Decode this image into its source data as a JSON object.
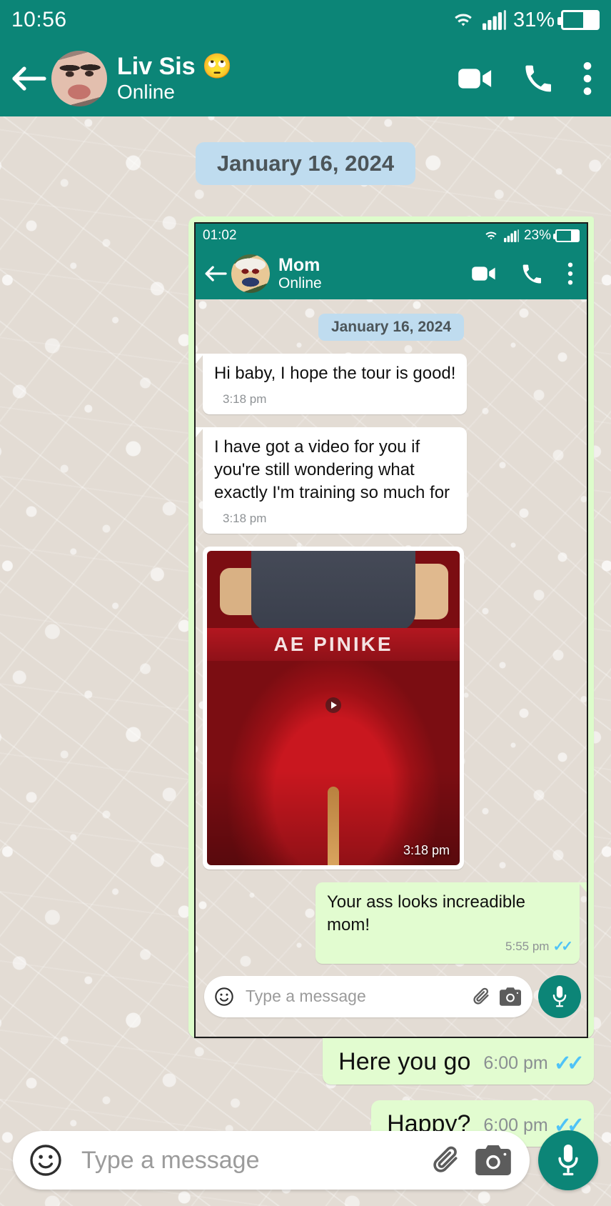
{
  "outer": {
    "status_bar": {
      "time": "10:56",
      "battery_percent": "31%",
      "wifi_icon": "wifi-icon",
      "signal_icon": "signal-icon",
      "battery_icon": "battery-icon"
    },
    "header": {
      "back_icon": "back-arrow-icon",
      "avatar": "contact-avatar",
      "name": "Liv Sis 🙄",
      "status": "Online",
      "video_call_icon": "video-call-icon",
      "voice_call_icon": "phone-call-icon",
      "menu_icon": "overflow-menu-icon"
    },
    "date_divider": "January 16, 2024",
    "messages": [
      {
        "type": "screenshot",
        "direction": "out"
      },
      {
        "type": "text",
        "direction": "out",
        "text": "Here you go",
        "time": "6:00 pm",
        "ticks": "read"
      },
      {
        "type": "text",
        "direction": "out",
        "text": "Happy?",
        "time": "6:00 pm",
        "ticks": "read"
      }
    ],
    "input_bar": {
      "emoji_icon": "emoji-icon",
      "placeholder": "Type a message",
      "attach_icon": "attachment-clip-icon",
      "camera_icon": "camera-icon",
      "mic_icon": "microphone-icon"
    }
  },
  "inner": {
    "status_bar": {
      "time": "01:02",
      "battery_percent": "23%",
      "wifi_icon": "wifi-icon",
      "signal_icon": "signal-icon",
      "battery_icon": "battery-icon"
    },
    "header": {
      "back_icon": "back-arrow-icon",
      "avatar": "contact-avatar",
      "name": "Mom",
      "status": "Online",
      "video_call_icon": "video-call-icon",
      "voice_call_icon": "phone-call-icon",
      "menu_icon": "overflow-menu-icon"
    },
    "date_divider": "January 16, 2024",
    "messages": [
      {
        "type": "text",
        "direction": "in",
        "text": "Hi baby, I hope the tour is good!",
        "time": "3:18 pm"
      },
      {
        "type": "text",
        "direction": "in",
        "text": "I have got a video for you if you're still wondering what exactly I'm training so much for",
        "time": "3:18 pm"
      },
      {
        "type": "media",
        "direction": "in",
        "time": "3:18 pm",
        "overlay_text": "AE PINIKE",
        "play_icon": "play-icon"
      },
      {
        "type": "text",
        "direction": "out",
        "text": "Your ass looks increadible mom!",
        "time": "5:55 pm",
        "ticks": "read"
      }
    ],
    "input_bar": {
      "emoji_icon": "emoji-icon",
      "placeholder": "Type a message",
      "attach_icon": "attachment-clip-icon",
      "camera_icon": "camera-icon",
      "mic_icon": "microphone-icon"
    }
  },
  "colors": {
    "header_green": "#0c8577",
    "outgoing_bubble": "#e2fcd0",
    "incoming_bubble": "#ffffff",
    "date_pill": "#bfdcef",
    "tick_blue": "#4fc3f7",
    "wallpaper": "#e3dcd4"
  }
}
